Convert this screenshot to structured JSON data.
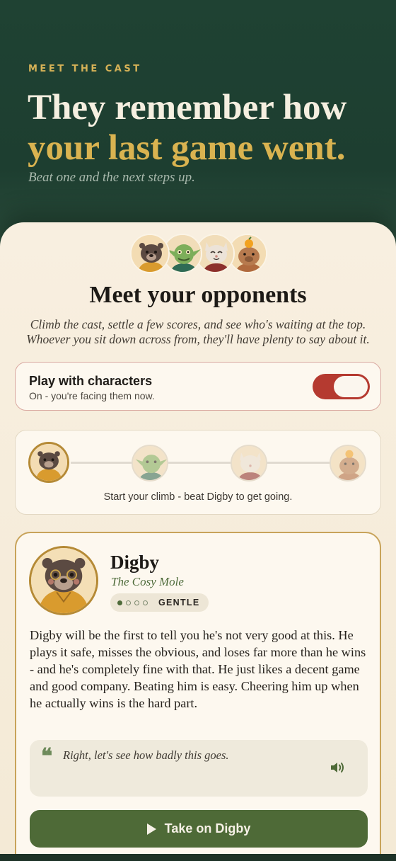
{
  "hero": {
    "eyebrow": "MEET THE CAST",
    "headline_line1": "They remember how",
    "headline_line2": "your last game went.",
    "subtitle": "Beat one and the next steps up."
  },
  "intro": {
    "avatars": [
      "mole-avatar",
      "goblin-avatar",
      "cat-avatar",
      "capybara-avatar"
    ],
    "title": "Meet your opponents",
    "lead": "Climb the cast, settle a few scores, and see who's waiting at the top. Whoever you sit down across from, they'll have plenty to say about it."
  },
  "toggle": {
    "title": "Play with characters",
    "subtitle": "On - you're facing them now.",
    "enabled": true
  },
  "ladder": {
    "steps": [
      "mole-avatar",
      "goblin-avatar",
      "cat-avatar",
      "capybara-avatar"
    ],
    "current_index": 0,
    "caption": "Start your climb - beat Digby to get going."
  },
  "opponent": {
    "name": "Digby",
    "epithet": "The Cosy Mole",
    "difficulty_level": 1,
    "difficulty_max": 4,
    "difficulty_label": "GENTLE",
    "bio": "Digby will be the first to tell you he's not very good at this. He plays it safe, misses the obvious, and loses far more than he wins - and he's completely fine with that. He just likes a decent game and good company. Beating him is easy. Cheering him up when he actually wins is the hard part.",
    "quote_mark": "❝",
    "quote": "Right, let's see how badly this goes.",
    "cta_label": "Take on Digby"
  },
  "colors": {
    "hero_bg": "#1f4233",
    "accent_gold": "#d9b350",
    "toggle_on": "#b53a30",
    "primary_green": "#4e6a37"
  }
}
